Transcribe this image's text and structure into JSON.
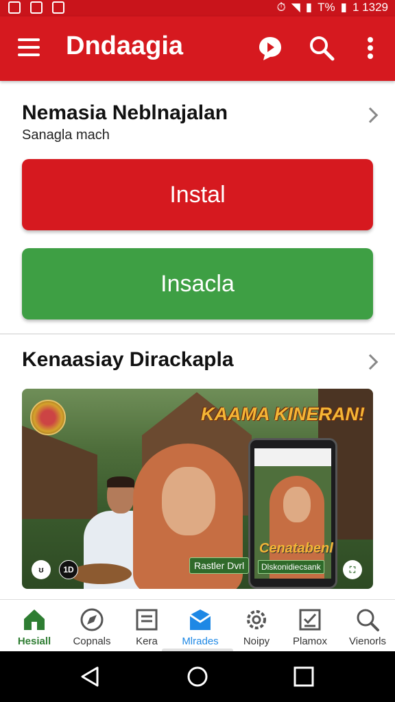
{
  "status_bar": {
    "battery_text": "T%",
    "time": "1 1329"
  },
  "app_bar": {
    "title": "Dndaagia"
  },
  "section1": {
    "title": "Nemasia Neblnajalan",
    "subtitle": "Sanagla mach",
    "primary_button": "Instal",
    "secondary_button": "Insacla"
  },
  "section2": {
    "title": "Kenaasiay Dirackapla",
    "banner": {
      "headline": "KAAMA KINERAN!",
      "phone_caption": "Cenatabenl",
      "tag_left": "Rastler Dvrl",
      "tag_right": "Dlskonidiecsank",
      "ctrl_a": "ʊ",
      "ctrl_b": "1D"
    }
  },
  "bottom_nav": [
    {
      "label": "Hesiall",
      "icon": "home-icon",
      "state": "active-green"
    },
    {
      "label": "Copnals",
      "icon": "compass-icon",
      "state": ""
    },
    {
      "label": "Kera",
      "icon": "document-icon",
      "state": ""
    },
    {
      "label": "Mlrades",
      "icon": "box-icon",
      "state": "active-blue"
    },
    {
      "label": "Noipy",
      "icon": "gear-icon",
      "state": ""
    },
    {
      "label": "Plamox",
      "icon": "checklist-icon",
      "state": ""
    },
    {
      "label": "Vienorls",
      "icon": "search-icon",
      "state": ""
    }
  ],
  "colors": {
    "primary_red": "#d6191f",
    "primary_green": "#3e9f44",
    "active_green": "#2e7d32",
    "active_blue": "#1e88e5"
  }
}
